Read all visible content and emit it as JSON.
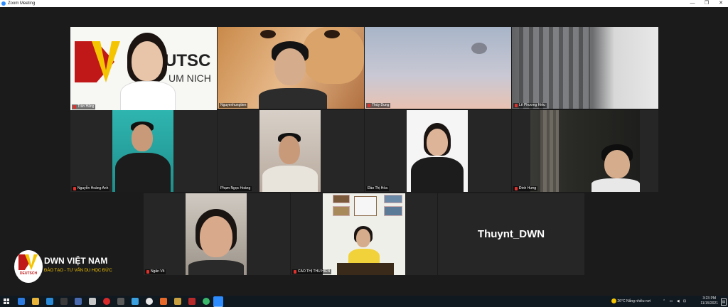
{
  "window": {
    "title": "Zoom Meeting"
  },
  "participants": [
    {
      "name": "Trần Hằng",
      "muted": true,
      "active_speaker": true
    },
    {
      "name": "Nguyenhungtien",
      "muted": false
    },
    {
      "name": "Thùy Dung",
      "muted": true
    },
    {
      "name": "Lê Phương Hiếu",
      "muted": true
    },
    {
      "name": "Nguyễn Hoàng Anh",
      "muted": true
    },
    {
      "name": "Phạm Ngọc Hoàng",
      "muted": false
    },
    {
      "name": "Đào Thị Hòa",
      "muted": false
    },
    {
      "name": "Đinh Hưng",
      "muted": true
    },
    {
      "name": "Ngân Võ",
      "muted": true
    },
    {
      "name": "CAO THỊ THU HIỀN",
      "muted": true
    },
    {
      "name": "Thuynt_DWN",
      "muted": true,
      "video_off": true
    }
  ],
  "watermark": {
    "brand": "DWN VIỆT NAM",
    "tagline": "ĐÀO TẠO - TƯ VẤN DU HỌC ĐỨC",
    "logo_text": "DEUTSCH"
  },
  "background_logo_text": "UTSC",
  "background_logo_sub": "UM NICH",
  "taskbar": {
    "weather": "26°C  Nắng nhiều nơi",
    "time": "3:23 PM",
    "date": "11/15/2021"
  },
  "colors": {
    "active_border": "#c8e64a",
    "mic_muted": "#e0302b",
    "brand_yellow": "#f5c400"
  }
}
